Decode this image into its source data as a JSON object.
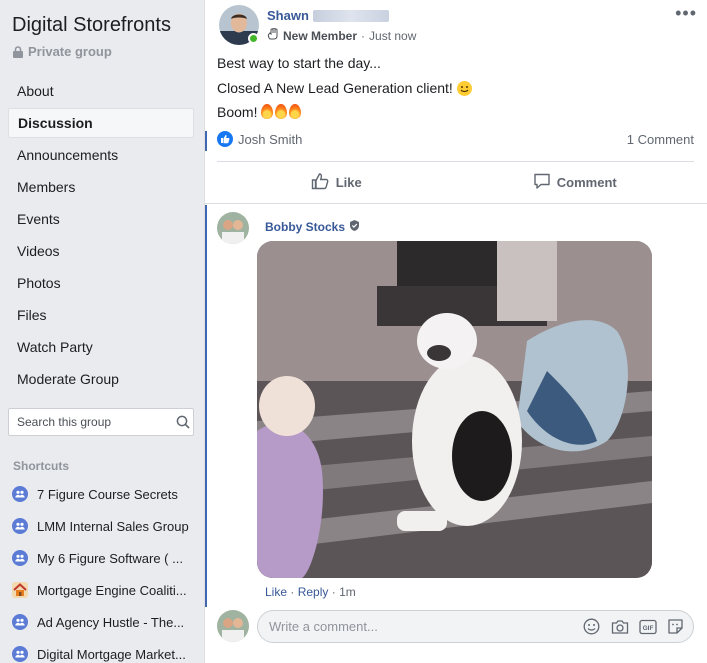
{
  "group": {
    "title": "Digital Storefronts",
    "privacy": "Private group"
  },
  "nav": [
    {
      "label": "About"
    },
    {
      "label": "Discussion",
      "active": true
    },
    {
      "label": "Announcements"
    },
    {
      "label": "Members"
    },
    {
      "label": "Events"
    },
    {
      "label": "Videos"
    },
    {
      "label": "Photos"
    },
    {
      "label": "Files"
    },
    {
      "label": "Watch Party"
    },
    {
      "label": "Moderate Group"
    }
  ],
  "search": {
    "placeholder": "Search this group"
  },
  "shortcuts": {
    "header": "Shortcuts",
    "items": [
      {
        "label": "7 Figure Course Secrets",
        "icon": "group-icon"
      },
      {
        "label": "LMM Internal Sales Group",
        "icon": "group-icon"
      },
      {
        "label": "My 6 Figure Software ( ...",
        "icon": "group-icon"
      },
      {
        "label": "Mortgage Engine Coaliti...",
        "icon": "house-icon"
      },
      {
        "label": "Ad Agency Hustle - The...",
        "icon": "group-icon"
      },
      {
        "label": "Digital Mortgage Market...",
        "icon": "group-icon"
      }
    ]
  },
  "post": {
    "author_first": "Shawn",
    "badge": "New Member",
    "separator": "·",
    "time": "Just now",
    "lines": [
      "Best way to start the day...",
      "Closed A New Lead Generation client!",
      "Boom!"
    ],
    "reactor": "Josh Smith",
    "comments_count": "1 Comment",
    "like_label": "Like",
    "comment_label": "Comment",
    "more_label": "•••"
  },
  "comment": {
    "author": "Bobby Stocks",
    "like": "Like",
    "reply": "Reply",
    "sep": "·",
    "time": "1m"
  },
  "composer": {
    "placeholder": "Write a comment..."
  },
  "colors": {
    "accent": "#385898",
    "like_blue": "#1877f2",
    "online": "#42b72a"
  }
}
